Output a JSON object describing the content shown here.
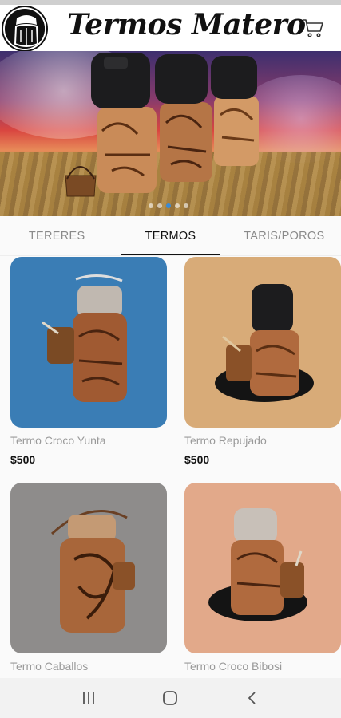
{
  "header": {
    "brand": "Termos Matero",
    "logo_icon": "mate-logo-icon",
    "cart_icon": "cart-icon"
  },
  "banner": {
    "slides": 5,
    "active_slide": 2
  },
  "tabs": [
    {
      "label": "TERERES",
      "active": false
    },
    {
      "label": "TERMOS",
      "active": true
    },
    {
      "label": "TARIS/POROS",
      "active": false
    }
  ],
  "products": [
    {
      "name": "Termo Croco Yunta",
      "price": "$500",
      "bg": "#3a7db5"
    },
    {
      "name": "Termo Repujado",
      "price": "$500",
      "bg": "#d8ab78"
    },
    {
      "name": "Termo Caballos",
      "price": "",
      "bg": "#8e8c8b"
    },
    {
      "name": "Termo Croco Bibosi",
      "price": "",
      "bg": "#e2a98a"
    }
  ],
  "navbar": {
    "recents_icon": "recents-icon",
    "home_icon": "home-icon",
    "back_icon": "back-icon"
  }
}
